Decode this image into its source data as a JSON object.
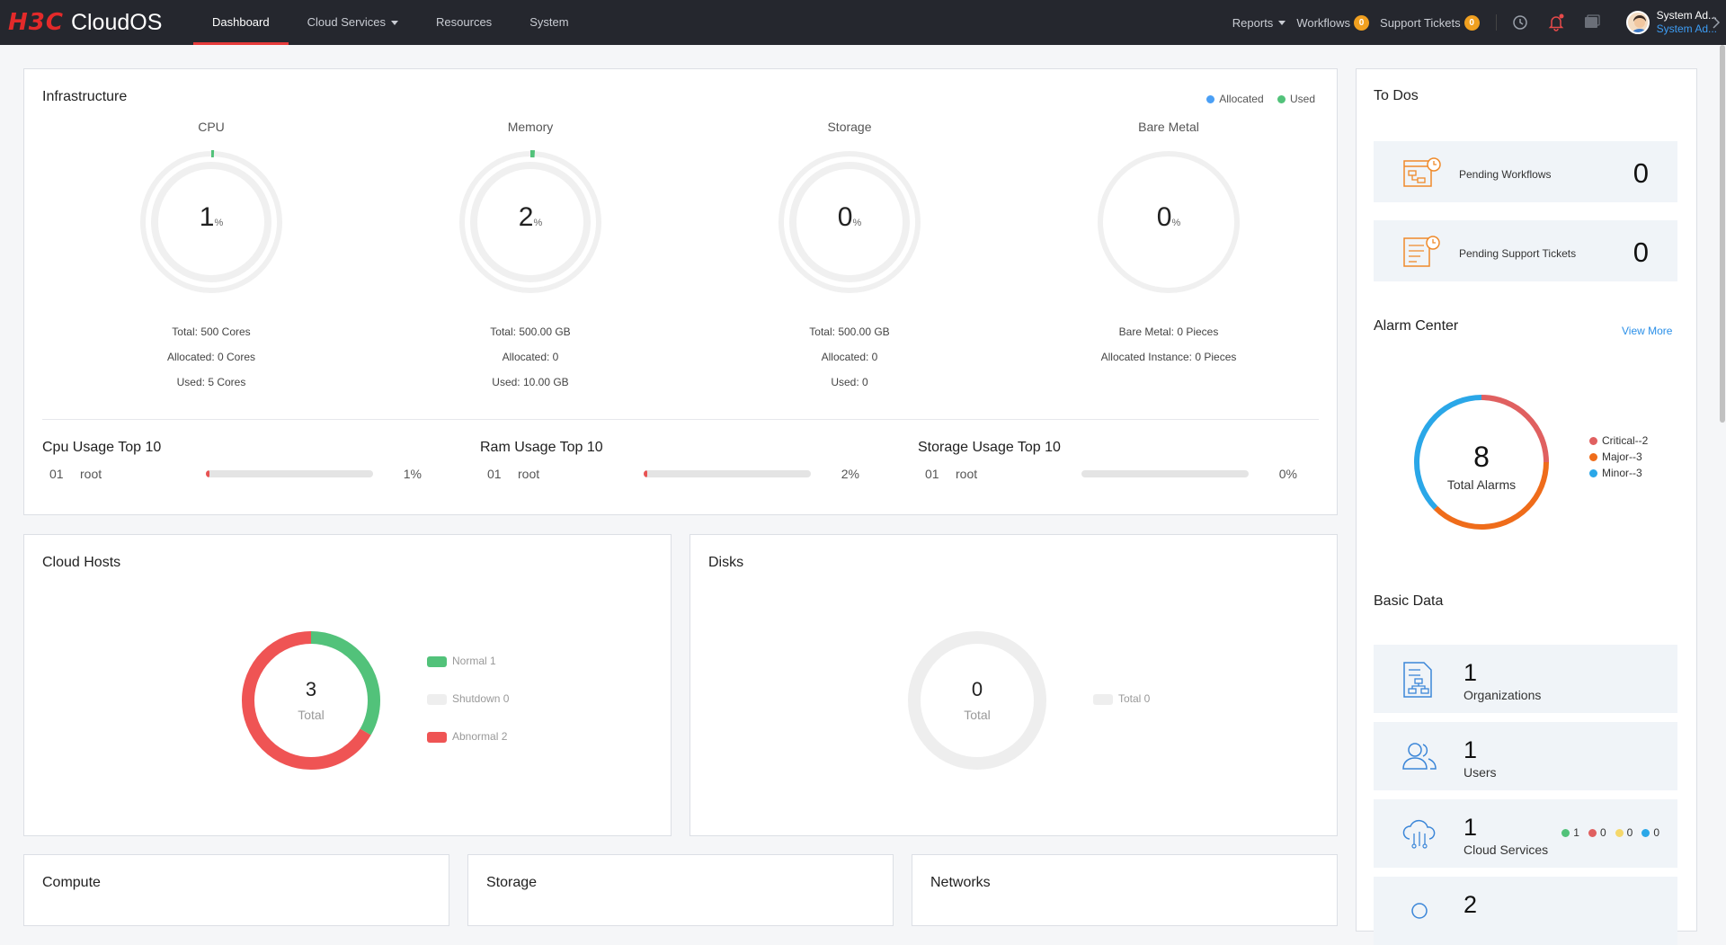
{
  "topbar": {
    "logo_mark": "H3C",
    "logo_text": "CloudOS",
    "nav": [
      {
        "label": "Dashboard",
        "active": true
      },
      {
        "label": "Cloud Services",
        "dropdown": true
      },
      {
        "label": "Resources"
      },
      {
        "label": "System"
      }
    ],
    "reports_label": "Reports",
    "workflows_label": "Workflows",
    "workflows_count": "0",
    "tickets_label": "Support Tickets",
    "tickets_count": "0",
    "user_name": "System Ad...",
    "user_role": "System Ad..."
  },
  "infrastructure": {
    "title": "Infrastructure",
    "legend_allocated": "Allocated",
    "legend_used": "Used",
    "colors": {
      "allocated": "#4a9ff5",
      "used": "#52c27a"
    },
    "gauges": [
      {
        "label": "CPU",
        "value": "1",
        "unit": "%",
        "used_pct": 1,
        "info": [
          "Total: 500 Cores",
          "Allocated: 0 Cores",
          "Used: 5 Cores"
        ]
      },
      {
        "label": "Memory",
        "value": "2",
        "unit": "%",
        "used_pct": 2,
        "info": [
          "Total: 500.00 GB",
          "Allocated: 0",
          "Used: 10.00 GB"
        ]
      },
      {
        "label": "Storage",
        "value": "0",
        "unit": "%",
        "used_pct": 0,
        "info": [
          "Total: 500.00 GB",
          "Allocated: 0",
          "Used: 0"
        ]
      },
      {
        "label": "Bare Metal",
        "value": "0",
        "unit": "%",
        "used_pct": 0,
        "info": [
          "Bare Metal: 0 Pieces",
          "Allocated Instance: 0 Pieces"
        ]
      }
    ],
    "usage": [
      {
        "title": "Cpu Usage Top 10",
        "rank": "01",
        "name": "root",
        "pct": "1%",
        "fill": 1
      },
      {
        "title": "Ram Usage Top 10",
        "rank": "01",
        "name": "root",
        "pct": "2%",
        "fill": 2
      },
      {
        "title": "Storage Usage Top 10",
        "rank": "01",
        "name": "root",
        "pct": "0%",
        "fill": 0
      }
    ]
  },
  "cloud_hosts": {
    "title": "Cloud Hosts",
    "total": "3",
    "total_label": "Total",
    "legend": [
      {
        "label": "Normal 1",
        "count": 1,
        "color": "#52c27a"
      },
      {
        "label": "Shutdown 0",
        "count": 0,
        "color": "#eeeeee"
      },
      {
        "label": "Abnormal 2",
        "count": 2,
        "color": "#ef5454"
      }
    ]
  },
  "disks": {
    "title": "Disks",
    "total": "0",
    "total_label": "Total",
    "legend": [
      {
        "label": "Total 0",
        "color": "#eeeeee"
      }
    ]
  },
  "bottom_panels": [
    "Compute",
    "Storage",
    "Networks"
  ],
  "todos": {
    "title": "To Dos",
    "items": [
      {
        "label": "Pending Workflows",
        "count": "0"
      },
      {
        "label": "Pending Support Tickets",
        "count": "0"
      }
    ]
  },
  "alarm_center": {
    "title": "Alarm Center",
    "view_more": "View More",
    "total": "8",
    "total_label": "Total Alarms",
    "legend": [
      {
        "label": "Critical--2",
        "count": 2,
        "color": "#e06060"
      },
      {
        "label": "Major--3",
        "count": 3,
        "color": "#ef6c1a"
      },
      {
        "label": "Minor--3",
        "count": 3,
        "color": "#2aa7e8"
      }
    ]
  },
  "basic_data": {
    "title": "Basic Data",
    "items": [
      {
        "num": "1",
        "label": "Organizations"
      },
      {
        "num": "1",
        "label": "Users"
      },
      {
        "num": "1",
        "label": "Cloud Services",
        "stats": [
          "1",
          "0",
          "0",
          "0"
        ]
      },
      {
        "num": "2",
        "label": "",
        "stats": [
          "",
          "",
          "",
          ""
        ]
      }
    ],
    "stat_colors": [
      "#52c27a",
      "#e06060",
      "#f5d86b",
      "#2aa7e8"
    ]
  }
}
